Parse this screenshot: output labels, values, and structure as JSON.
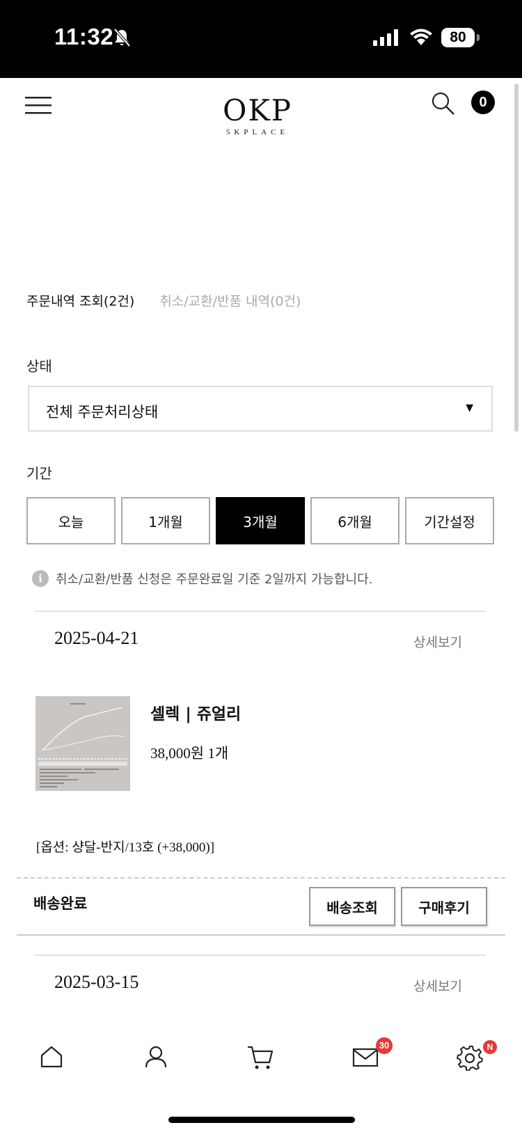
{
  "status_bar": {
    "time": "11:32",
    "battery": "80"
  },
  "header": {
    "logo_main": "OKP",
    "logo_sub": "5KPLACE",
    "cart_count": "0"
  },
  "tabs": [
    {
      "label": "주문내역 조회(2건)",
      "active": true
    },
    {
      "label": "취소/교환/반품 내역(0건)",
      "active": false
    }
  ],
  "filters": {
    "status_label": "상태",
    "status_value": "전체 주문처리상태",
    "period_label": "기간",
    "periods": [
      "오늘",
      "1개월",
      "3개월",
      "6개월",
      "기간설정"
    ],
    "active_period": "3개월"
  },
  "notice": "취소/교환/반품 신청은 주문완료일 기준 2일까지 가능합니다.",
  "orders": [
    {
      "date": "2025-04-21",
      "detail_label": "상세보기",
      "product_name": "셀렉 | 쥬얼리",
      "price_qty": "38,000원 1개",
      "option": "[옵션: 샹달-반지/13호 (+38,000)]",
      "status": "배송완료",
      "actions": [
        "배송조회",
        "구매후기"
      ]
    },
    {
      "date": "2025-03-15",
      "detail_label": "상세보기"
    }
  ],
  "bottom_nav": {
    "items": [
      "home-icon",
      "user-icon",
      "cart-icon",
      "mail-icon",
      "settings-icon"
    ],
    "mail_badge": "30",
    "settings_badge": "N",
    "badge_color": "#e43a3a"
  }
}
